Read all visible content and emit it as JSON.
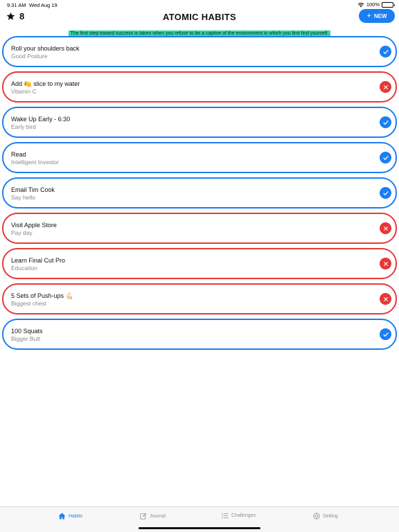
{
  "status_bar": {
    "time": "9:31 AM",
    "date": "Wed Aug 19",
    "battery_text": "100%",
    "battery_level": 1.0
  },
  "header": {
    "streak_icon": "star-icon",
    "streak_count": "8",
    "title": "ATOMIC HABITS",
    "new_button": {
      "icon": "plus-icon",
      "label": "NEW"
    }
  },
  "quote": "The first step toward success is taken when you refuse to be a captive of the environment in which you first find yourself.",
  "colors": {
    "accent_blue": "#1a7ff2",
    "failed_red": "#e53939",
    "quote_highlight": "#2fd9a6"
  },
  "habits": [
    {
      "title": "Roll your shoulders back",
      "subtitle": "Good Posture",
      "status": "done",
      "icon": "checkmark-icon"
    },
    {
      "title": "Add 🍋 slice to my water",
      "subtitle": "Vitamin C",
      "status": "missed",
      "icon": "close-icon"
    },
    {
      "title": "Wake Up Early - 6:30",
      "subtitle": "Early bird",
      "status": "done",
      "icon": "checkmark-icon"
    },
    {
      "title": "Read",
      "subtitle": "Intelligent Investor",
      "status": "done",
      "icon": "checkmark-icon"
    },
    {
      "title": "Email Tim Cook",
      "subtitle": "Say hello",
      "status": "done",
      "icon": "checkmark-icon"
    },
    {
      "title": "Visit Apple Store",
      "subtitle": "Pay day",
      "status": "missed",
      "icon": "close-icon"
    },
    {
      "title": "Learn Final Cut Pro",
      "subtitle": "Education",
      "status": "missed",
      "icon": "close-icon"
    },
    {
      "title": "5 Sets of Push-ups 💪🏻",
      "subtitle": "Biggest chest",
      "status": "missed",
      "icon": "close-icon"
    },
    {
      "title": "100 Squats",
      "subtitle": "Bigger Butt",
      "status": "done",
      "icon": "checkmark-icon"
    }
  ],
  "tabs": [
    {
      "label": "Habits",
      "icon": "house-icon",
      "active": true
    },
    {
      "label": "Journal",
      "icon": "compose-icon",
      "active": false
    },
    {
      "label": "Challenges",
      "icon": "list-icon",
      "active": false
    },
    {
      "label": "Setting",
      "icon": "gear-icon",
      "active": false
    }
  ]
}
